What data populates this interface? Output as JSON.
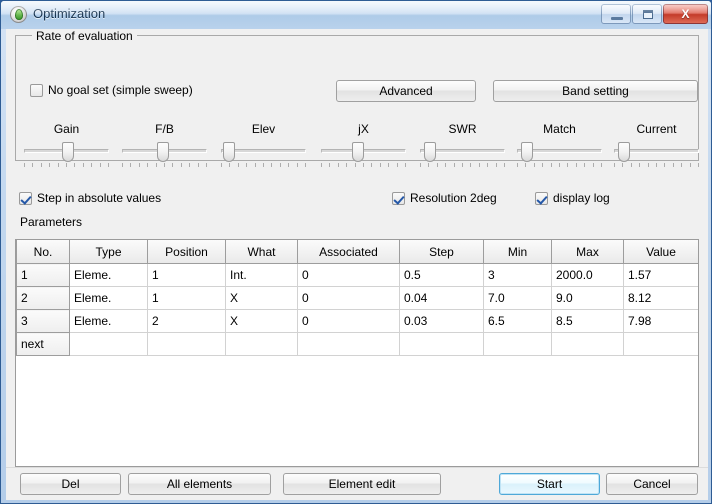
{
  "window": {
    "title": "Optimization",
    "icon": "app-icon",
    "controls": {
      "minimize": "minimize-icon",
      "maximize": "maximize-icon",
      "close": "X"
    }
  },
  "group": {
    "legend": "Rate of evaluation",
    "no_goal": {
      "label": "No goal set (simple sweep)",
      "checked": false
    },
    "advanced_button": "Advanced",
    "band_setting_button": "Band setting",
    "sliders": [
      {
        "label": "Gain",
        "value": 52
      },
      {
        "label": "F/B",
        "value": 48
      },
      {
        "label": "Elev",
        "value": 3
      },
      {
        "label": "jX",
        "value": 43
      },
      {
        "label": "SWR",
        "value": 5
      },
      {
        "label": "Match",
        "value": 5
      },
      {
        "label": "Current",
        "value": 5
      }
    ]
  },
  "options": {
    "step_absolute": {
      "label": "Step in absolute values",
      "checked": true
    },
    "resolution": {
      "label": "Resolution 2deg",
      "checked": true
    },
    "display_log": {
      "label": "display log",
      "checked": true
    }
  },
  "parameters": {
    "label": "Parameters",
    "columns": [
      "No.",
      "Type",
      "Position",
      "What",
      "Associated",
      "Step",
      "Min",
      "Max",
      "Value"
    ],
    "rows": [
      {
        "no": "1",
        "type": "Eleme.",
        "position": "1",
        "what": "Int.",
        "associated": "0",
        "step": "0.5",
        "min": "3",
        "max": "2000.0",
        "value": "1.57"
      },
      {
        "no": "2",
        "type": "Eleme.",
        "position": "1",
        "what": "X",
        "associated": "0",
        "step": "0.04",
        "min": "7.0",
        "max": "9.0",
        "value": "8.12"
      },
      {
        "no": "3",
        "type": "Eleme.",
        "position": "2",
        "what": "X",
        "associated": "0",
        "step": "0.03",
        "min": "6.5",
        "max": "8.5",
        "value": "7.98"
      },
      {
        "no": "next",
        "type": "",
        "position": "",
        "what": "",
        "associated": "",
        "step": "",
        "min": "",
        "max": "",
        "value": ""
      }
    ]
  },
  "footer": {
    "del": "Del",
    "all_elements": "All elements",
    "element_edit": "Element edit",
    "start": "Start",
    "cancel": "Cancel"
  },
  "colors": {
    "accent": "#2b5d9e",
    "default_button_border": "#4ea8d8",
    "close_button": "#c33a29"
  }
}
